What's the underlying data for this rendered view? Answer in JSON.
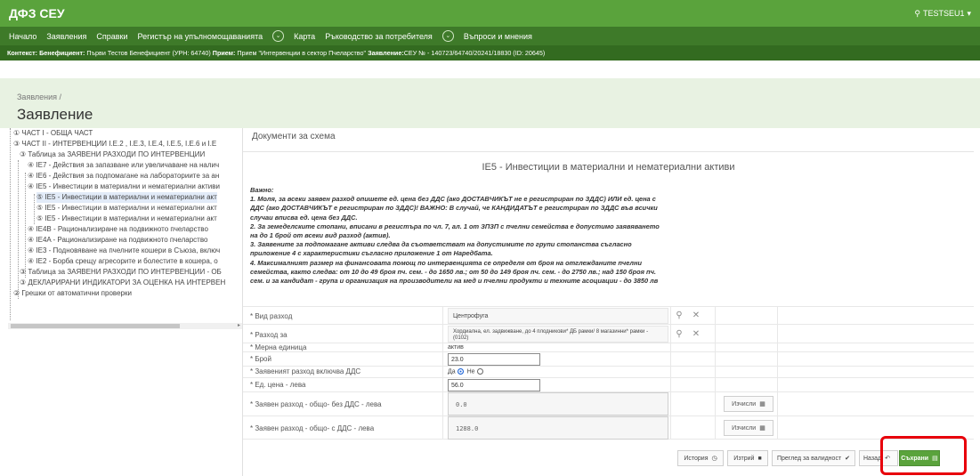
{
  "app": {
    "title": "ДФЗ СЕУ",
    "user": "TESTSEU1"
  },
  "nav": {
    "items": [
      "Начало",
      "Заявления",
      "Справки",
      "Регистър на упълномощаванията",
      "Карта",
      "Ръководство за потребителя",
      "Въпроси и мнения"
    ]
  },
  "context": {
    "label1": "Контекст:",
    "beneficiary_label": "Бенефициент:",
    "beneficiary_value": "Първи Тестов Бенефициент (УРН: 64740)",
    "reception_label": "Прием:",
    "reception_value": "Прием \"Интервенции в сектор Пчеларство\"",
    "application_label": "Заявление:",
    "application_value": "СЕУ № - 140723/64740/20241/18830 (ID: 20645)"
  },
  "header": {
    "breadcrumb": "Заявления /",
    "title": "Заявление"
  },
  "tree": {
    "nodes": [
      "① ЧАСТ I - ОБЩА ЧАСТ",
      "③ ЧАСТ II - ИНТЕРВЕНЦИИ I.E.2 , I.E.3, I.E.4, I.E.5, I.E.6 и I.E",
      "③ Таблица за ЗАЯВЕНИ РАЗХОДИ ПО ИНТЕРВЕНЦИИ",
      "④ IE7 - Действия за запазване или увеличаване на налич",
      "④ IE6 - Действия за подпомагане на лабораториите за ан",
      "④ IE5 - Инвестиции в материални и нематериални активи",
      "⑤ IE5 - Инвестиции в материални и нематериални акт",
      "⑤ IE5 - Инвестиции в материални и нематериални акт",
      "⑤ IE5 - Инвестиции в материални и нематериални акт",
      "④ IE4B - Рационализиране на подвижното пчеларство",
      "④ IE4A - Рационализиране на подвижното пчеларство",
      "④ IE3 - Подновяване на пчелните кошери в Съюза, включ",
      "④ IE2 - Борба срещу агресорите и болестите в кошера, о",
      "③ Таблица за ЗАЯВЕНИ РАЗХОДИ ПО ИНТЕРВЕНЦИИ - ОБ",
      "③ ДЕКЛАРИРАНИ ИНДИКАТОРИ ЗА ОЦЕНКА НА ИНТЕРВЕН",
      "② Грешки от автоматични проверки"
    ]
  },
  "panel": {
    "title": "Документи за схема",
    "form_title": "IE5 - Инвестиции в материални и нематериални активи",
    "note_lines": [
      "Важно:",
      "1. Моля, за всеки заявен разход опишете ед. цена без ДДС (ако ДОСТАВЧИКЪТ не е регистриран по ЗДДС) ИЛИ ед. цена с",
      "ДДС (ако ДОСТАВЧИКЪТ е регистриран по ЗДДС)! ВАЖНО: В случай, че КАНДИДАТЪТ е регистриран по ЗДДС във всички",
      "случаи вписва ед. цена без ДДС.",
      "2. За земеделските стопани, вписани в регистъра по чл. 7, ал. 1 от ЗПЗП с пчелни семейства е допустимо заявяването",
      "на до 1 брой от всеки вид разход (актив).",
      "3. Заявените за подпомагане активи следва да съответстват на допустимите по групи стопанства съгласно",
      "приложение 4 с характеристики съгласно приложение 1 от Наредбата.",
      "4. Максималният размер на финансовата помощ по интервенцията се определя от броя на отглежданите пчелни",
      "семейства, както следва: от 10 до 49 броя пч. сем. - до 1650 лв.; от 50 до 149 броя пч. сем. - до 2750 лв.; над 150 броя пч.",
      "сем. и за кандидат - група и организация на производители на мед и пчелни продукти и техните асоциации - до 3850 лв"
    ]
  },
  "form": {
    "expense_type_label": "* Вид разход",
    "expense_type_value": "Центрофуга",
    "expense_for_label": "* Разход за",
    "expense_for_value": "Хордиална, ел. задвижване, до 4 плодникови* ДБ рамки/ 8 магазинни* рамки - (0102)",
    "unit_label": "* Мерна единица",
    "unit_value": "актив",
    "count_label": "* Брой",
    "count_value": "23.0",
    "vat_label": "* Заявеният разход включва ДДС",
    "vat_yes": "Да",
    "vat_no": "Не",
    "unit_price_label": "* Ед. цена - лева",
    "unit_price_value": "56.0",
    "total_no_vat_label": "* Заявен разход - общо- без ДДС - лева",
    "total_no_vat_value": "0.0",
    "total_vat_label": "* Заявен разход - общо- с ДДС - лева",
    "total_vat_value": "1288.0",
    "calc_label": "Изчисли"
  },
  "actions": {
    "history": "История",
    "delete": "Изтрий",
    "validity": "Преглед за валидност",
    "back": "Назад",
    "save": "Съхрани"
  },
  "colors": {
    "topbar": "#5aa33c",
    "navbar": "#3e7a29",
    "context": "#336b20",
    "highlight": "#e8000b"
  }
}
